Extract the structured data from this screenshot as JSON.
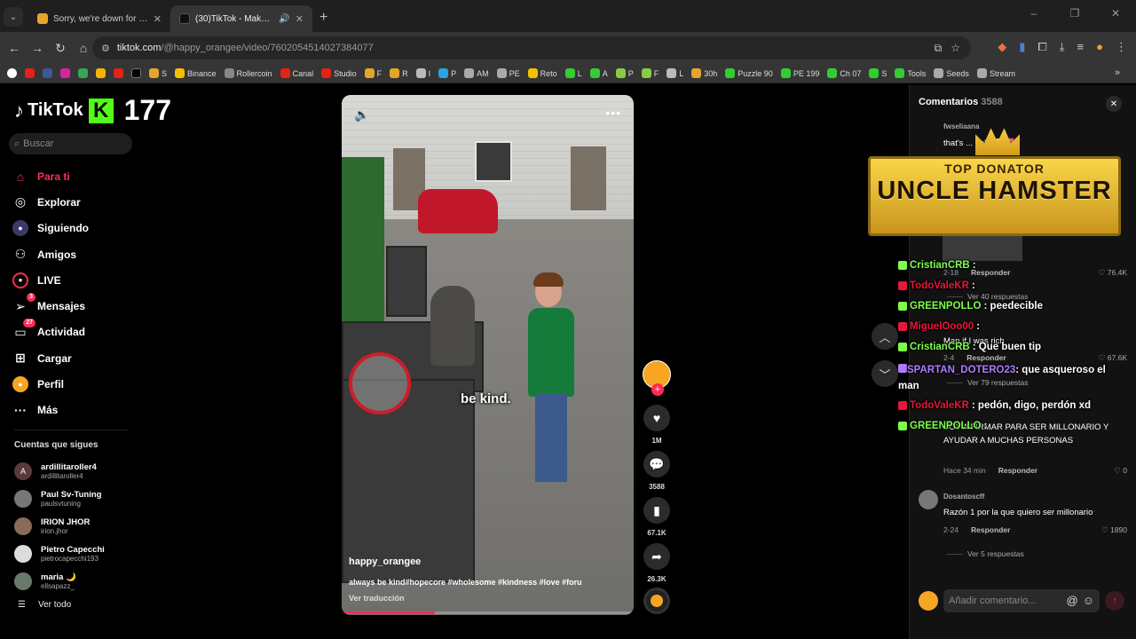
{
  "browser": {
    "tabs": [
      {
        "title": "Sorry, we're down for maintena",
        "active": false
      },
      {
        "title": "(30)TikTok - Make Your Day",
        "active": true
      }
    ],
    "url_host": "tiktok.com",
    "url_path": "/@happy_orangee/video/7602054514027384077",
    "bookmarks": [
      "S",
      "Binance",
      "Rollercoin",
      "Canal",
      "Studio",
      "F",
      "R",
      "I",
      "P",
      "AM",
      "PE",
      "Reto",
      "L",
      "A",
      "P",
      "F",
      "L",
      "30h",
      "Puzzle 90",
      "PE 199",
      "Ch 07",
      "S",
      "Tools",
      "Seeds",
      "Stream"
    ]
  },
  "tiktok": {
    "logo_text": "TikTok",
    "kick_letter": "K",
    "viewer_count": "177",
    "search_placeholder": "Buscar",
    "nav": [
      {
        "label": "Para ti",
        "icon": "home-icon",
        "active": true
      },
      {
        "label": "Explorar",
        "icon": "compass-icon"
      },
      {
        "label": "Siguiendo",
        "icon": "following-icon"
      },
      {
        "label": "Amigos",
        "icon": "friends-icon"
      },
      {
        "label": "LIVE",
        "icon": "live-icon"
      },
      {
        "label": "Mensajes",
        "icon": "messages-icon",
        "badge": "3"
      },
      {
        "label": "Actividad",
        "icon": "activity-icon",
        "badge": "27"
      },
      {
        "label": "Cargar",
        "icon": "upload-icon"
      },
      {
        "label": "Perfil",
        "icon": "profile-icon"
      },
      {
        "label": "Más",
        "icon": "more-icon"
      }
    ],
    "following_title": "Cuentas que sigues",
    "following": [
      {
        "name": "ardillitaroller4",
        "user": "ardillitaroller4",
        "initial": "A"
      },
      {
        "name": "Paul Sv-Tuning",
        "user": "paulsvtuning"
      },
      {
        "name": "IRION JHOR",
        "user": "irion.jhor"
      },
      {
        "name": "Pietro Capecchi",
        "user": "pietrocapecchi193"
      },
      {
        "name": "maria 🌙",
        "user": "ellsapazz_"
      }
    ],
    "see_all": "Ver todo"
  },
  "video": {
    "caption_overlay": "be kind.",
    "author": "happy_orangee",
    "description": "always be kind#hopecore #wholesome #kindness #love #foru",
    "translate": "Ver traducción",
    "progress_percent": 32,
    "likes": "1M",
    "comments": "3588",
    "saves": "67.1K",
    "shares": "26.3K"
  },
  "comments": {
    "title": "Comentarios",
    "count": "3588",
    "items": [
      {
        "user": "fwseliaana",
        "text": "that's ... baby🥺💞"
      },
      {
        "meta_time": "2-18",
        "reply": "Responder",
        "likes": "76.4K",
        "more": "Ver 40 respuestas"
      },
      {
        "user": "...",
        "text": "Man if I was rich",
        "meta_time": "2-4",
        "reply": "Responder",
        "likes": "67.6K",
        "more": "Ver 79 respuestas"
      },
      {
        "text": "VOY A FIRMAR PARA SER MILLONARIO Y AYUDAR A MUCHAS PERSONAS",
        "meta_time": "Hace 34 min",
        "reply": "Responder",
        "likes": "0"
      },
      {
        "user": "Dosantoscff",
        "text": "Razón 1 por la que quiero ser millonario",
        "meta_time": "2-24",
        "reply": "Responder",
        "likes": "1890",
        "more": "Ver 5 respuestas"
      }
    ],
    "input_placeholder": "Añadir comentario..."
  },
  "overlay": {
    "donator_title": "TOP DONATOR",
    "donator_name": "UNCLE HAMSTER",
    "chat": [
      {
        "user": "CristianCRB",
        "text": ":",
        "color": "#7cff4a"
      },
      {
        "user": "TodoValeKR",
        "text": ":",
        "color": "#e8173a"
      },
      {
        "user": "GREENPOLLO",
        "text": ": peedecible",
        "color": "#7cff4a"
      },
      {
        "user": "MiguelOoo00",
        "text": ":",
        "color": "#e8173a"
      },
      {
        "user": "CristianCRB",
        "text": ": Que buen tip",
        "color": "#7cff4a"
      },
      {
        "user": "SPARTAN_DOTERO23",
        "text": ": que asqueroso el man",
        "color": "#b07cff"
      },
      {
        "user": "TodoValeKR",
        "text": ": pedón, digo, perdón xd",
        "color": "#e8173a"
      },
      {
        "user": "GREENPOLLO",
        "text": ":",
        "color": "#7cff4a"
      }
    ]
  }
}
